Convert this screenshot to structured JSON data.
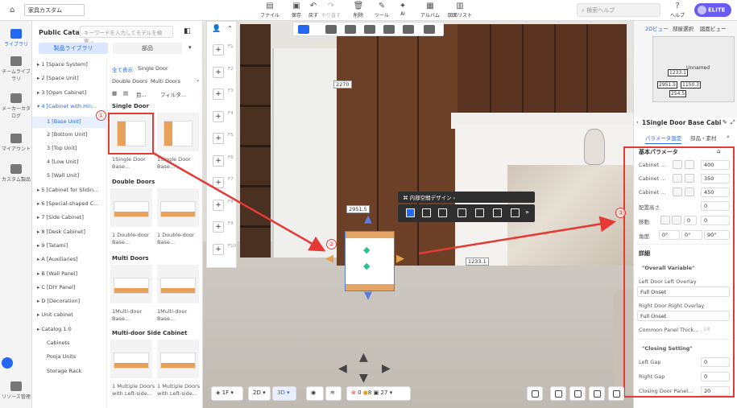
{
  "header": {
    "project_title": "家具カスタム",
    "toolbar": [
      {
        "label": "ファイル",
        "icon": "file-icon"
      },
      {
        "label": "保存",
        "icon": "save-icon"
      },
      {
        "label": "戻す",
        "icon": "undo-icon"
      },
      {
        "label": "やり直す",
        "icon": "redo-icon"
      },
      {
        "label": "削除",
        "icon": "delete-icon"
      },
      {
        "label": "ツール",
        "icon": "tool-icon"
      },
      {
        "label": "AI",
        "icon": "ai-icon"
      },
      {
        "label": "アルバム",
        "icon": "album-icon"
      },
      {
        "label": "図面リスト",
        "icon": "drawing-list-icon"
      }
    ],
    "search_placeholder": "検索ヘルプ",
    "help_label": "ヘルプ",
    "plan_label": "ELITE"
  },
  "rail": [
    {
      "label": "ライブラリ",
      "icon": "library-icon",
      "active": true
    },
    {
      "label": "チームライブラリ",
      "icon": "team-library-icon"
    },
    {
      "label": "メーカーカタログ",
      "icon": "maker-catalog-icon"
    },
    {
      "label": "マイアウント",
      "icon": "my-account-icon"
    },
    {
      "label": "カスタム製品",
      "icon": "custom-product-icon"
    },
    {
      "label": "リソース管理",
      "icon": "resource-icon"
    }
  ],
  "catalog": {
    "title": "Public Catalog",
    "search_placeholder": "キーワードを入力してモデルを検索...",
    "tabs": [
      "製品ライブラリ",
      "部品"
    ],
    "tree": [
      {
        "label": "1 [Space System]",
        "type": "cat"
      },
      {
        "label": "2 [Space Unit]",
        "type": "cat"
      },
      {
        "label": "3 [Open Cabinet]",
        "type": "cat"
      },
      {
        "label": "4 [Cabinet with Hin...",
        "type": "open"
      },
      {
        "label": "1 [Base Unit]",
        "type": "selected"
      },
      {
        "label": "2 [Bottom Unit]",
        "type": "sub"
      },
      {
        "label": "3 [Top Unit]",
        "type": "sub"
      },
      {
        "label": "4 [Low Unit]",
        "type": "sub"
      },
      {
        "label": "5 [Wall Unit]",
        "type": "sub"
      },
      {
        "label": "5 [Cabinet for Slidin...",
        "type": "cat"
      },
      {
        "label": "6 [Special-shaped C...",
        "type": "cat"
      },
      {
        "label": "7 [Side Cabinet]",
        "type": "cat"
      },
      {
        "label": "8 [Desk Cabinet]",
        "type": "cat"
      },
      {
        "label": "9 [Tatami]",
        "type": "cat"
      },
      {
        "label": "A [Auxiliaries]",
        "type": "cat"
      },
      {
        "label": "B [Wall Panel]",
        "type": "cat"
      },
      {
        "label": "C [DIY Panel]",
        "type": "cat"
      },
      {
        "label": "D [Decoration]",
        "type": "cat"
      },
      {
        "label": "Unit cabinet",
        "type": "cat"
      },
      {
        "label": "Catalog 1.0",
        "type": "cat"
      },
      {
        "label": "Cabinets",
        "type": "sub"
      },
      {
        "label": "Pooja Units",
        "type": "sub"
      },
      {
        "label": "Storage Rack",
        "type": "sub"
      }
    ],
    "crumb_all": "全て表示",
    "crumb_current": "Single Door",
    "filters": [
      "Double Doors",
      "Multi Doors"
    ],
    "view_filter": "フィルタ...",
    "view_list_label": "目...",
    "sections": [
      {
        "title": "Single Door",
        "items": [
          "1Single Door Base...",
          "1Single Door Base..."
        ]
      },
      {
        "title": "Double Doors",
        "items": [
          "1 Double-door Base...",
          "1 Double-door Base..."
        ]
      },
      {
        "title": "Multi Doors",
        "items": [
          "1Multi-door Base...",
          "1Multi-door Base..."
        ]
      },
      {
        "title": "Multi-door Side Cabinet",
        "items": [
          "1 Multiple Doors with Left-side...",
          "1 Multiple Doors with Left-side..."
        ]
      }
    ]
  },
  "floor_keys": [
    "F1",
    "F2",
    "F3",
    "F4",
    "F5",
    "F6",
    "F7",
    "F8",
    "F9",
    "F10"
  ],
  "viewport": {
    "selection_toolbar_label": "内部空間デザイン",
    "dim_height": "2270",
    "dim_top": "2951.5",
    "dim_right": "1233.1",
    "markers": [
      "①",
      "②",
      "③"
    ]
  },
  "right_top": {
    "tabs": [
      "2Dビュー",
      "部屋選択",
      "図面ビュー"
    ],
    "minimap_labels": [
      "1233.1",
      "2951.5",
      "1150.3",
      "254.5",
      "Unnamed"
    ]
  },
  "props": {
    "title": "1Single Door Base Cabin...",
    "tabs": [
      "パラメータ設定",
      "部品・素材"
    ],
    "basic_section": "基本パラメータ",
    "rows": [
      {
        "label": "Cabinet ...",
        "value": "400"
      },
      {
        "label": "Cabinet ...",
        "value": "350"
      },
      {
        "label": "Cabinet ...",
        "value": "450"
      }
    ],
    "elevation_label": "配置高さ",
    "elevation_value": "0",
    "move_label": "移動",
    "move_value": "0",
    "move_value2": "0",
    "angle_label": "角度",
    "angles": [
      "0°",
      "0°",
      "90°"
    ],
    "detail_section": "詳細",
    "overall_var": "\"Overall Variable\"",
    "left_overlay_label": "Left Door Left Overlay",
    "left_overlay_value": "Full Onset",
    "right_overlay_label": "Right Door Right Overlay",
    "right_overlay_value": "Full Onset",
    "panel_thick_label": "Common Panel Thick...",
    "panel_thick_value": "18",
    "closing_section": "\"Closing Setting\"",
    "left_gap_label": "Left Gap",
    "left_gap_value": "0",
    "right_gap_label": "Right Gap",
    "right_gap_value": "0",
    "closing_panel_label": "Closing Door Panel...",
    "closing_panel_value": "20"
  },
  "bottom": {
    "floor": "1F",
    "view2d": "2D",
    "view3d": "3D",
    "errors": "0",
    "warnings": "8",
    "count": "27"
  },
  "colors": {
    "accent": "#2468f2",
    "annotation": "#e53935"
  }
}
